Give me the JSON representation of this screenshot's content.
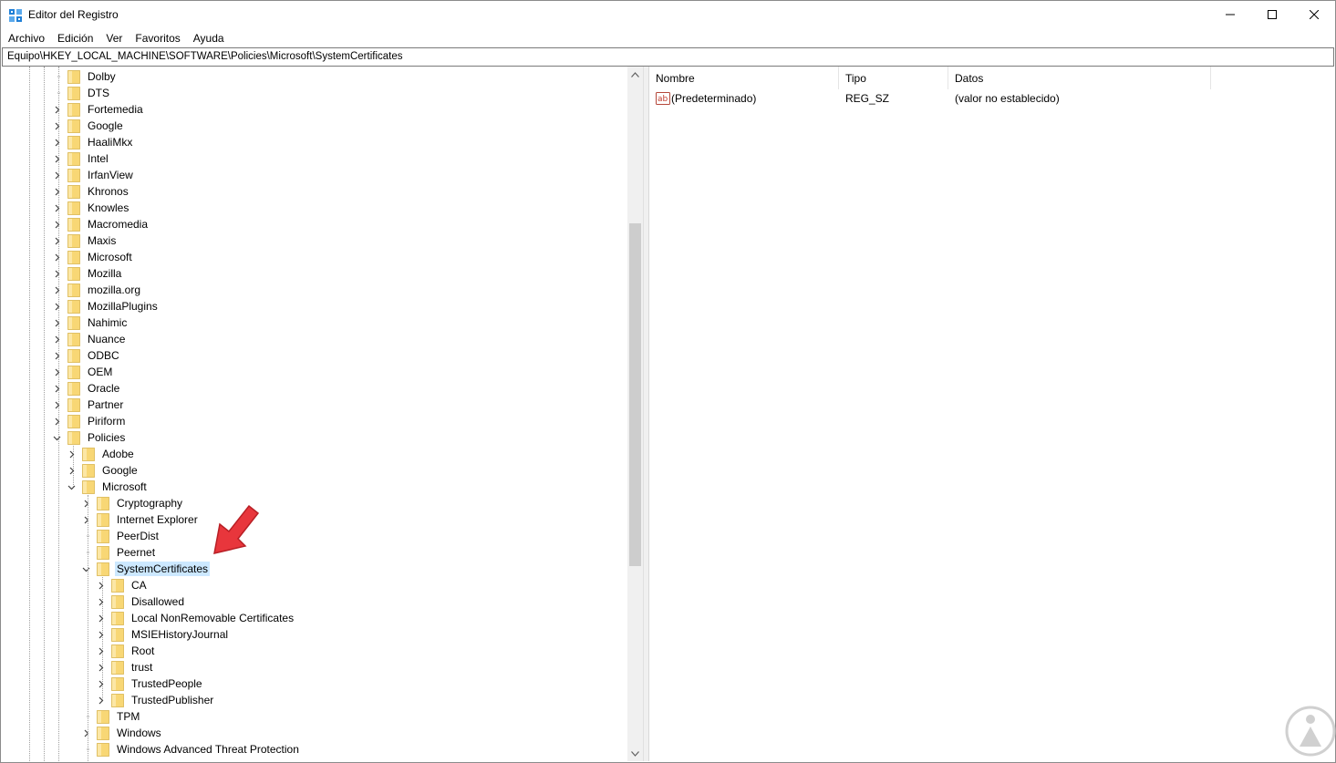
{
  "window": {
    "title": "Editor del Registro",
    "controls": {
      "minimize": "minimize-icon",
      "maximize": "maximize-icon",
      "close": "close-icon"
    }
  },
  "menu": [
    "Archivo",
    "Edición",
    "Ver",
    "Favoritos",
    "Ayuda"
  ],
  "address": "Equipo\\HKEY_LOCAL_MACHINE\\SOFTWARE\\Policies\\Microsoft\\SystemCertificates",
  "tree": [
    {
      "label": "Dolby",
      "level": 0,
      "expander": "none"
    },
    {
      "label": "DTS",
      "level": 0,
      "expander": "none"
    },
    {
      "label": "Fortemedia",
      "level": 0,
      "expander": "collapsed"
    },
    {
      "label": "Google",
      "level": 0,
      "expander": "collapsed"
    },
    {
      "label": "HaaliMkx",
      "level": 0,
      "expander": "collapsed"
    },
    {
      "label": "Intel",
      "level": 0,
      "expander": "collapsed"
    },
    {
      "label": "IrfanView",
      "level": 0,
      "expander": "collapsed"
    },
    {
      "label": "Khronos",
      "level": 0,
      "expander": "collapsed"
    },
    {
      "label": "Knowles",
      "level": 0,
      "expander": "collapsed"
    },
    {
      "label": "Macromedia",
      "level": 0,
      "expander": "collapsed"
    },
    {
      "label": "Maxis",
      "level": 0,
      "expander": "collapsed"
    },
    {
      "label": "Microsoft",
      "level": 0,
      "expander": "collapsed"
    },
    {
      "label": "Mozilla",
      "level": 0,
      "expander": "collapsed"
    },
    {
      "label": "mozilla.org",
      "level": 0,
      "expander": "collapsed"
    },
    {
      "label": "MozillaPlugins",
      "level": 0,
      "expander": "collapsed"
    },
    {
      "label": "Nahimic",
      "level": 0,
      "expander": "collapsed"
    },
    {
      "label": "Nuance",
      "level": 0,
      "expander": "collapsed"
    },
    {
      "label": "ODBC",
      "level": 0,
      "expander": "collapsed"
    },
    {
      "label": "OEM",
      "level": 0,
      "expander": "collapsed"
    },
    {
      "label": "Oracle",
      "level": 0,
      "expander": "collapsed"
    },
    {
      "label": "Partner",
      "level": 0,
      "expander": "collapsed"
    },
    {
      "label": "Piriform",
      "level": 0,
      "expander": "collapsed"
    },
    {
      "label": "Policies",
      "level": 0,
      "expander": "expanded"
    },
    {
      "label": "Adobe",
      "level": 1,
      "expander": "collapsed"
    },
    {
      "label": "Google",
      "level": 1,
      "expander": "collapsed"
    },
    {
      "label": "Microsoft",
      "level": 1,
      "expander": "expanded"
    },
    {
      "label": "Cryptography",
      "level": 2,
      "expander": "collapsed"
    },
    {
      "label": "Internet Explorer",
      "level": 2,
      "expander": "collapsed"
    },
    {
      "label": "PeerDist",
      "level": 2,
      "expander": "none"
    },
    {
      "label": "Peernet",
      "level": 2,
      "expander": "none"
    },
    {
      "label": "SystemCertificates",
      "level": 2,
      "expander": "expanded",
      "selected": true
    },
    {
      "label": "CA",
      "level": 3,
      "expander": "collapsed"
    },
    {
      "label": "Disallowed",
      "level": 3,
      "expander": "collapsed"
    },
    {
      "label": "Local NonRemovable Certificates",
      "level": 3,
      "expander": "collapsed"
    },
    {
      "label": "MSIEHistoryJournal",
      "level": 3,
      "expander": "collapsed"
    },
    {
      "label": "Root",
      "level": 3,
      "expander": "collapsed"
    },
    {
      "label": "trust",
      "level": 3,
      "expander": "collapsed"
    },
    {
      "label": "TrustedPeople",
      "level": 3,
      "expander": "collapsed"
    },
    {
      "label": "TrustedPublisher",
      "level": 3,
      "expander": "collapsed"
    },
    {
      "label": "TPM",
      "level": 2,
      "expander": "none"
    },
    {
      "label": "Windows",
      "level": 2,
      "expander": "collapsed"
    },
    {
      "label": "Windows Advanced Threat Protection",
      "level": 2,
      "expander": "none"
    }
  ],
  "list": {
    "columns": [
      "Nombre",
      "Tipo",
      "Datos"
    ],
    "rows": [
      {
        "name": "(Predeterminado)",
        "type": "REG_SZ",
        "data": "(valor no establecido)",
        "icon": "string-value-icon"
      }
    ]
  },
  "colors": {
    "selection": "#cce8ff",
    "folder": "#f8d775",
    "annotation_arrow": "#e8363c"
  }
}
